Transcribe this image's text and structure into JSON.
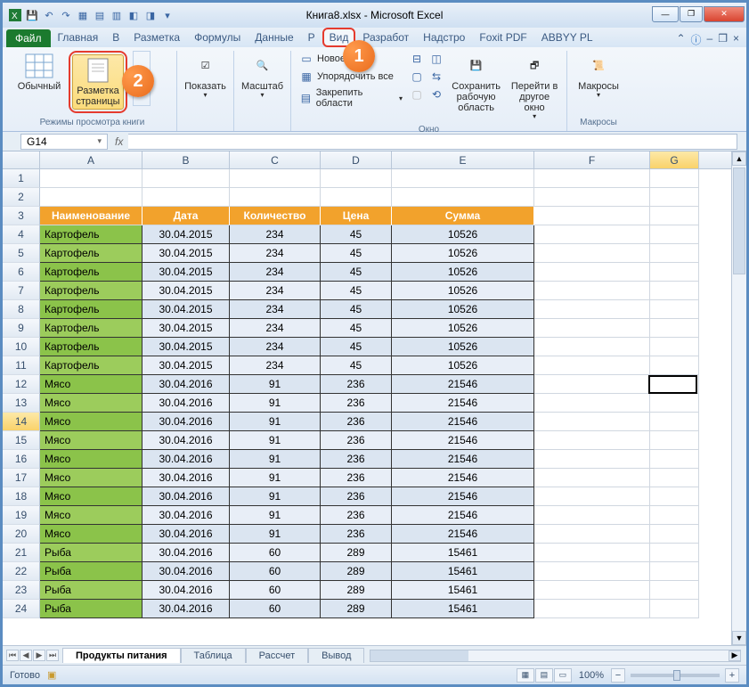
{
  "title": "Книга8.xlsx - Microsoft Excel",
  "qat": [
    "excel",
    "save",
    "undo",
    "redo",
    "q1",
    "q2",
    "q3",
    "q4",
    "q5",
    "q6",
    "q7"
  ],
  "tabs": {
    "file": "Файл",
    "items": [
      "Главная",
      "В",
      "Разметка",
      "Формулы",
      "Данные",
      "Р",
      "Вид",
      "Разработ",
      "Надстро",
      "Foxit PDF",
      "ABBYY PL"
    ]
  },
  "ribbon": {
    "group_views": {
      "normal": "Обычный",
      "page_layout_l1": "Разметка",
      "page_layout_l2": "страницы",
      "label": "Режимы просмотра книги"
    },
    "group_show": {
      "btn": "Показать"
    },
    "group_zoom": {
      "btn": "Масштаб"
    },
    "group_window": {
      "new_window": "Новое окно",
      "arrange": "Упорядочить все",
      "freeze": "Закрепить области",
      "save_ws_l1": "Сохранить",
      "save_ws_l2": "рабочую область",
      "switch_l1": "Перейти в",
      "switch_l2": "другое окно",
      "label": "Окно"
    },
    "group_macros": {
      "btn": "Макросы",
      "label": "Макросы"
    }
  },
  "callouts": {
    "one": "1",
    "two": "2"
  },
  "namebox": "G14",
  "formula_fx": "fx",
  "columns": [
    "A",
    "B",
    "C",
    "D",
    "E",
    "F",
    "G"
  ],
  "headers": {
    "name": "Наименование",
    "date": "Дата",
    "qty": "Количество",
    "price": "Цена",
    "sum": "Сумма"
  },
  "rows": [
    {
      "n": 4,
      "name": "Картофель",
      "date": "30.04.2015",
      "qty": "234",
      "price": "45",
      "sum": "10526"
    },
    {
      "n": 5,
      "name": "Картофель",
      "date": "30.04.2015",
      "qty": "234",
      "price": "45",
      "sum": "10526"
    },
    {
      "n": 6,
      "name": "Картофель",
      "date": "30.04.2015",
      "qty": "234",
      "price": "45",
      "sum": "10526"
    },
    {
      "n": 7,
      "name": "Картофель",
      "date": "30.04.2015",
      "qty": "234",
      "price": "45",
      "sum": "10526"
    },
    {
      "n": 8,
      "name": "Картофель",
      "date": "30.04.2015",
      "qty": "234",
      "price": "45",
      "sum": "10526"
    },
    {
      "n": 9,
      "name": "Картофель",
      "date": "30.04.2015",
      "qty": "234",
      "price": "45",
      "sum": "10526"
    },
    {
      "n": 10,
      "name": "Картофель",
      "date": "30.04.2015",
      "qty": "234",
      "price": "45",
      "sum": "10526"
    },
    {
      "n": 11,
      "name": "Картофель",
      "date": "30.04.2015",
      "qty": "234",
      "price": "45",
      "sum": "10526"
    },
    {
      "n": 12,
      "name": "Мясо",
      "date": "30.04.2016",
      "qty": "91",
      "price": "236",
      "sum": "21546"
    },
    {
      "n": 13,
      "name": "Мясо",
      "date": "30.04.2016",
      "qty": "91",
      "price": "236",
      "sum": "21546"
    },
    {
      "n": 14,
      "name": "Мясо",
      "date": "30.04.2016",
      "qty": "91",
      "price": "236",
      "sum": "21546"
    },
    {
      "n": 15,
      "name": "Мясо",
      "date": "30.04.2016",
      "qty": "91",
      "price": "236",
      "sum": "21546"
    },
    {
      "n": 16,
      "name": "Мясо",
      "date": "30.04.2016",
      "qty": "91",
      "price": "236",
      "sum": "21546"
    },
    {
      "n": 17,
      "name": "Мясо",
      "date": "30.04.2016",
      "qty": "91",
      "price": "236",
      "sum": "21546"
    },
    {
      "n": 18,
      "name": "Мясо",
      "date": "30.04.2016",
      "qty": "91",
      "price": "236",
      "sum": "21546"
    },
    {
      "n": 19,
      "name": "Мясо",
      "date": "30.04.2016",
      "qty": "91",
      "price": "236",
      "sum": "21546"
    },
    {
      "n": 20,
      "name": "Мясо",
      "date": "30.04.2016",
      "qty": "91",
      "price": "236",
      "sum": "21546"
    },
    {
      "n": 21,
      "name": "Рыба",
      "date": "30.04.2016",
      "qty": "60",
      "price": "289",
      "sum": "15461"
    },
    {
      "n": 22,
      "name": "Рыба",
      "date": "30.04.2016",
      "qty": "60",
      "price": "289",
      "sum": "15461"
    },
    {
      "n": 23,
      "name": "Рыба",
      "date": "30.04.2016",
      "qty": "60",
      "price": "289",
      "sum": "15461"
    },
    {
      "n": 24,
      "name": "Рыба",
      "date": "30.04.2016",
      "qty": "60",
      "price": "289",
      "sum": "15461"
    }
  ],
  "active_row_header": 14,
  "sheet_tabs": [
    "Продукты питания",
    "Таблица",
    "Рассчет",
    "Вывод"
  ],
  "status": {
    "ready": "Готово",
    "zoom": "100%"
  }
}
